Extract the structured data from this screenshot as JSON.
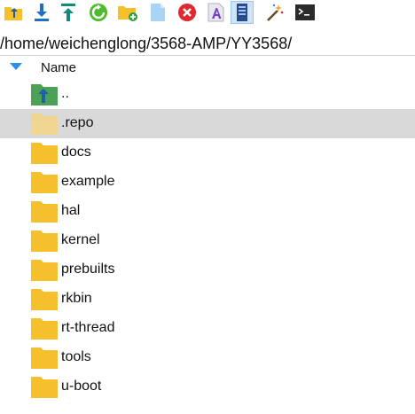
{
  "toolbar": {
    "buttons": [
      {
        "name": "parent-folder-icon"
      },
      {
        "name": "download-icon"
      },
      {
        "name": "upload-icon"
      },
      {
        "name": "refresh-icon"
      },
      {
        "name": "new-folder-icon"
      },
      {
        "name": "new-file-icon"
      },
      {
        "name": "delete-icon"
      },
      {
        "name": "rename-icon"
      },
      {
        "name": "properties-icon"
      },
      {
        "name": "magic-wand-icon"
      },
      {
        "name": "terminal-icon"
      }
    ]
  },
  "path_bar": {
    "path": "/home/weichenglong/3568-AMP/YY3568/"
  },
  "list": {
    "header": {
      "name_label": "Name"
    },
    "items": [
      {
        "label": "..",
        "type": "parent"
      },
      {
        "label": ".repo",
        "type": "folder-hidden",
        "selected": true
      },
      {
        "label": "docs",
        "type": "folder"
      },
      {
        "label": "example",
        "type": "folder"
      },
      {
        "label": "hal",
        "type": "folder"
      },
      {
        "label": "kernel",
        "type": "folder"
      },
      {
        "label": "prebuilts",
        "type": "folder"
      },
      {
        "label": "rkbin",
        "type": "folder"
      },
      {
        "label": "rt-thread",
        "type": "folder"
      },
      {
        "label": "tools",
        "type": "folder"
      },
      {
        "label": "u-boot",
        "type": "folder"
      }
    ]
  },
  "colors": {
    "folder": "#f6c02c",
    "folder_hidden": "#efd690",
    "selected_row": "#d9d9d9",
    "accent": "#2c8ee6"
  }
}
